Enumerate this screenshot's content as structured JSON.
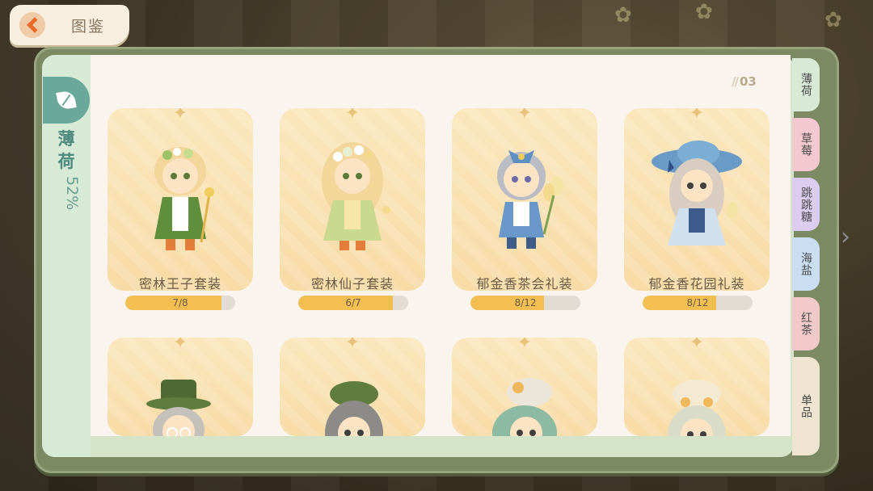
{
  "header": {
    "back_label": "图鉴"
  },
  "category": {
    "name": "薄荷",
    "percent": "52%"
  },
  "page_number": "03",
  "right_tabs": [
    {
      "label": "薄荷",
      "color": "#d8ead6"
    },
    {
      "label": "草莓",
      "color": "#f3c8d0"
    },
    {
      "label": "跳跳糖",
      "color": "#dccdf0"
    },
    {
      "label": "海盐",
      "color": "#c9ddf3"
    },
    {
      "label": "红茶",
      "color": "#f2c9c9"
    },
    {
      "label": "单品",
      "color": "#efe4cf"
    }
  ],
  "cards": [
    {
      "name": "密林王子套装",
      "progress_text": "7/8",
      "progress": 0.875
    },
    {
      "name": "密林仙子套装",
      "progress_text": "6/7",
      "progress": 0.857
    },
    {
      "name": "郁金香茶会礼装",
      "progress_text": "8/12",
      "progress": 0.667
    },
    {
      "name": "郁金香花园礼装",
      "progress_text": "8/12",
      "progress": 0.667
    }
  ],
  "colors": {
    "accent": "#6aa89a",
    "progress": "#f3bf52",
    "frame": "#7c8a63"
  }
}
